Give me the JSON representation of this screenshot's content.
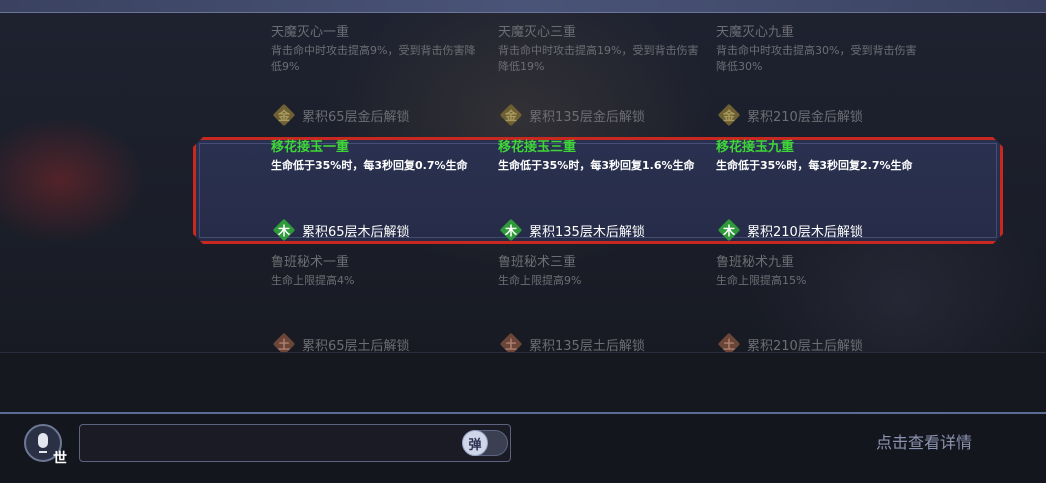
{
  "rows": [
    {
      "state": "locked",
      "element": "金",
      "cells": [
        {
          "name": "天魔灭心一重",
          "desc": "背击命中时攻击提高9%，受到背击伤害降低9%",
          "unlock": "累积65层金后解锁"
        },
        {
          "name": "天魔灭心三重",
          "desc": "背击命中时攻击提高19%，受到背击伤害降低19%",
          "unlock": "累积135层金后解锁"
        },
        {
          "name": "天魔灭心九重",
          "desc": "背击命中时攻击提高30%，受到背击伤害降低30%",
          "unlock": "累积210层金后解锁"
        }
      ]
    },
    {
      "state": "active",
      "element": "木",
      "cells": [
        {
          "name": "移花接玉一重",
          "desc": "生命低于35%时，每3秒回复0.7%生命",
          "unlock": "累积65层木后解锁"
        },
        {
          "name": "移花接玉三重",
          "desc": "生命低于35%时，每3秒回复1.6%生命",
          "unlock": "累积135层木后解锁"
        },
        {
          "name": "移花接玉九重",
          "desc": "生命低于35%时，每3秒回复2.7%生命",
          "unlock": "累积210层木后解锁"
        }
      ]
    },
    {
      "state": "locked",
      "element": "土",
      "cells": [
        {
          "name": "鲁班秘术一重",
          "desc": "生命上限提高4%",
          "unlock": "累积65层土后解锁"
        },
        {
          "name": "鲁班秘术三重",
          "desc": "生命上限提高9%",
          "unlock": "累积135层土后解锁"
        },
        {
          "name": "鲁班秘术九重",
          "desc": "生命上限提高15%",
          "unlock": "累积210层土后解锁"
        }
      ]
    }
  ],
  "chat": {
    "channel_tag": "世",
    "danmu_label": "弹",
    "details_link": "点击查看详情"
  },
  "icons": {
    "mic": "microphone-icon",
    "element_badge": "element-diamond-icon"
  },
  "colors": {
    "active_title": "#3fd637",
    "active_border": "#c8281f",
    "wood_badge": "#2f9a3a",
    "gold_badge": "#6e6033",
    "earth_badge": "#6a4538"
  }
}
